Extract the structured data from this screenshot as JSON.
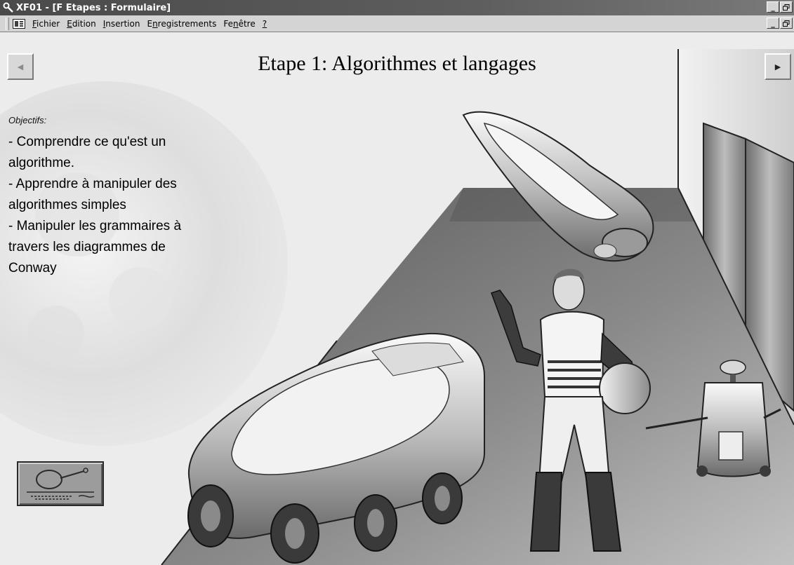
{
  "window": {
    "title": "XF01 - [F Etapes : Formulaire]",
    "buttons": {
      "minimize": "_",
      "restore": "ⲉ"
    }
  },
  "menubar": {
    "items": [
      {
        "key": "fichier",
        "mnemonic": "F",
        "rest": "ichier"
      },
      {
        "key": "edition",
        "mnemonic": "E",
        "rest": "dition"
      },
      {
        "key": "insertion",
        "mnemonic": "I",
        "rest": "nsertion"
      },
      {
        "key": "enregistrements",
        "pre": "E",
        "mnemonic": "n",
        "rest": "registrements"
      },
      {
        "key": "fenetre",
        "pre": "Fe",
        "mnemonic": "n",
        "rest": "être"
      },
      {
        "key": "help",
        "mnemonic": "?",
        "rest": ""
      }
    ]
  },
  "page": {
    "title": "Etape 1: Algorithmes et langages",
    "objectives_heading": "Objectifs:",
    "objectives_lines": [
      "- Comprendre ce qu'est un",
      "algorithme.",
      "- Apprendre à manipuler des",
      "algorithmes simples",
      "- Manipuler les grammaires à",
      "travers les diagrammes de",
      "Conway"
    ]
  },
  "nav": {
    "prev_icon": "arrow-left-icon",
    "next_icon": "arrow-right-icon"
  },
  "tool_button": {
    "icon": "magnifier-blueprint-icon"
  },
  "colors": {
    "titlebar": "#4a4a4a",
    "chrome": "#d4d4d4",
    "content_bg": "#e9e9e9"
  }
}
